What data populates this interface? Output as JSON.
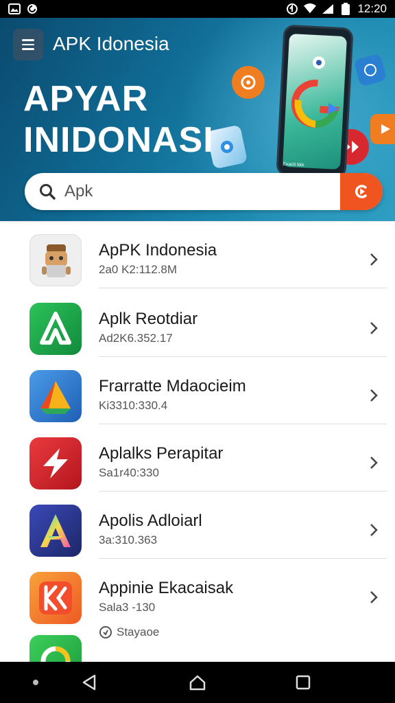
{
  "status_bar": {
    "time": "12:20",
    "left_icons": [
      "gallery-icon",
      "sync-icon"
    ],
    "right_icons": [
      "vpn-icon",
      "wifi-icon",
      "signal-icon",
      "battery-icon"
    ]
  },
  "header": {
    "app_title": "APK Idonesia",
    "hero_line1": "APYAR",
    "hero_line2": "INIDONASI",
    "phone_caption": "Exacit kkk"
  },
  "search": {
    "value": "Apk",
    "placeholder": "Apk"
  },
  "apps": [
    {
      "name": "ApPK Indonesia",
      "meta": "2a0 K2:112.8M",
      "icon": "mascot-icon",
      "color": "#f2f2f2"
    },
    {
      "name": "Aplk Reotdiar",
      "meta": "Ad2K6.352.17",
      "icon": "a-logo-icon",
      "color": "#1aa34a"
    },
    {
      "name": "Frarratte Mdaocieim",
      "meta": "Ki3310:330.4",
      "icon": "triangle-logo-icon",
      "color": "#2f7fd6"
    },
    {
      "name": "Aplalks Perapitar",
      "meta": "Sa1r40:330",
      "icon": "arrow-logo-icon",
      "color": "#d7282f"
    },
    {
      "name": "Apolis Adloiarl",
      "meta": "3a:310.363",
      "icon": "a-gradient-icon",
      "color": "#2c3a96"
    },
    {
      "name": "Appinie Ekacaisak",
      "meta": "Sala3 -130",
      "icon": "ks-logo-icon",
      "color": "#f47a2a"
    }
  ],
  "storage_note": "Stayaoe",
  "partial_app": {
    "icon": "circle-logo-icon",
    "color": "#29b34a"
  },
  "nav": {
    "buttons": [
      "recents-dot-icon",
      "back-icon",
      "home-icon",
      "overview-icon"
    ]
  },
  "colors": {
    "accent": "#f0541f",
    "hero_dark": "#0b4a6f",
    "hero_light": "#2e9fc2"
  }
}
